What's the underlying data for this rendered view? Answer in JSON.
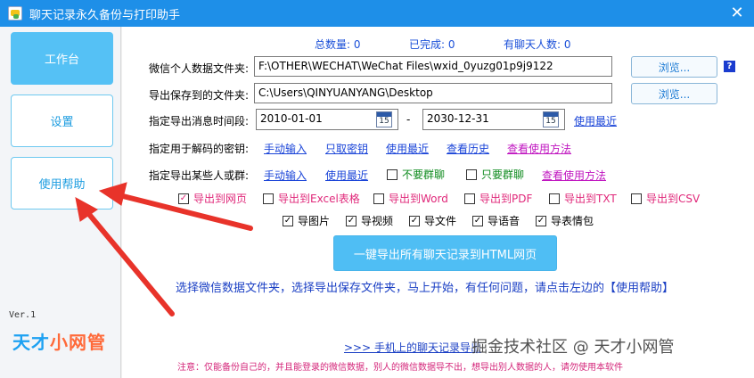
{
  "window": {
    "title": "聊天记录永久备份与打印助手",
    "close_glyph": "✕"
  },
  "sidebar": {
    "items": [
      {
        "label": "工作台",
        "active": true
      },
      {
        "label": "设置",
        "active": false
      },
      {
        "label": "使用帮助",
        "active": false
      }
    ],
    "version": "Ver.1",
    "brand_a": "天才",
    "brand_b": "小网管"
  },
  "stats": {
    "total": "总数量: 0",
    "done": "已完成: 0",
    "contacts": "有聊天人数: 0"
  },
  "form": {
    "data_folder_label": "微信个人数据文件夹:",
    "data_folder_value": "F:\\OTHER\\WECHAT\\WeChat Files\\wxid_0yuzg01p9j9122",
    "save_folder_label": "导出保存到的文件夹:",
    "save_folder_value": "C:\\Users\\QINYUANYANG\\Desktop",
    "browse_label": "浏览...",
    "help_glyph": "?",
    "date_label": "指定导出消息时间段:",
    "date_from": "2010-01-01",
    "date_to": "2030-12-31",
    "date_sep": "-",
    "cal_day": "15",
    "use_recent": "使用最近",
    "key_label": "指定用于解码的密钥:",
    "key_links": [
      "手动输入",
      "只取密钥",
      "使用最近",
      "查看历史"
    ],
    "key_help": "查看使用方法",
    "who_label": "指定导出某些人或群:",
    "who_links": [
      "手动输入",
      "使用最近"
    ],
    "no_group": "不要群聊",
    "only_group": "只要群聊",
    "who_help": "查看使用方法"
  },
  "exports": [
    {
      "label": "导出到网页",
      "checked": true
    },
    {
      "label": "导出到Excel表格",
      "checked": false
    },
    {
      "label": "导出到Word",
      "checked": false
    },
    {
      "label": "导出到PDF",
      "checked": false
    },
    {
      "label": "导出到TXT",
      "checked": false
    },
    {
      "label": "导出到CSV",
      "checked": false
    }
  ],
  "media": [
    {
      "label": "导图片",
      "checked": true
    },
    {
      "label": "导视频",
      "checked": true
    },
    {
      "label": "导文件",
      "checked": true
    },
    {
      "label": "导语音",
      "checked": true
    },
    {
      "label": "导表情包",
      "checked": true
    }
  ],
  "check_glyph": "✓",
  "actions": {
    "export_all": "一键导出所有聊天记录到HTML网页"
  },
  "hint": "选择微信数据文件夹，选择导出保存文件夹，马上开始，有任何问题，请点击左边的【使用帮助】",
  "mobile_link": ">>>   手机上的聊天记录导出",
  "note": "注意：仅能备份自己的，并且能登录的微信数据，别人的微信数据导不出，想导出别人数据的人，请勿使用本软件",
  "watermark": "掘金技术社区 @ 天才小网管",
  "colors": {
    "accent": "#1e8fe8",
    "button": "#4fbef4",
    "link": "#1a44d8",
    "arrow": "#e8332a"
  }
}
